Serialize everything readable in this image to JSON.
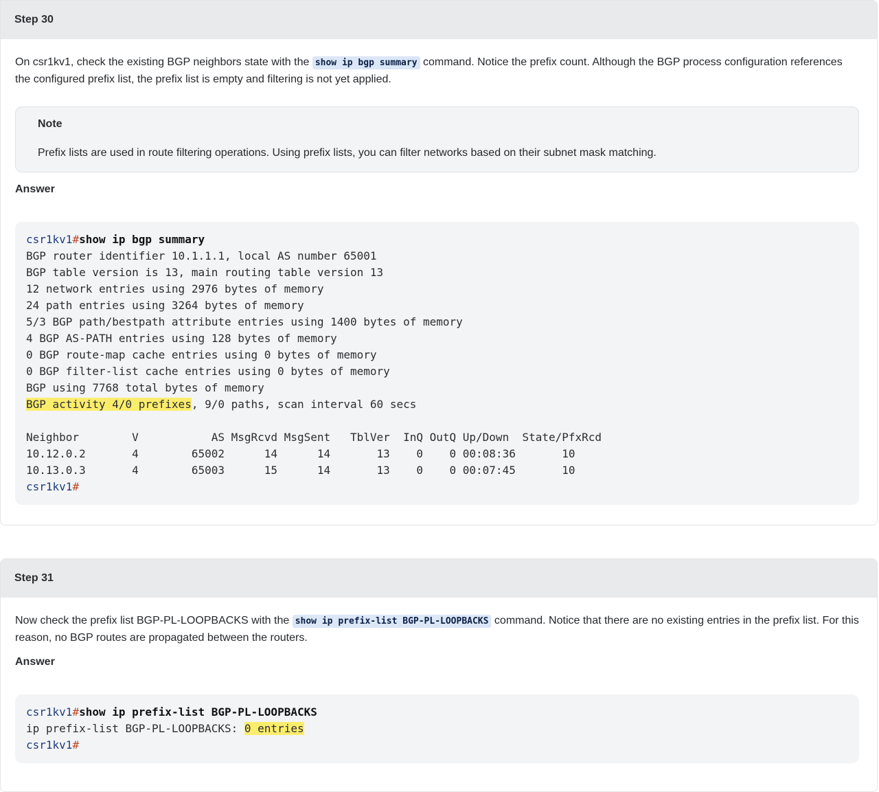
{
  "step30": {
    "title": "Step 30",
    "intro_before": "On csr1kv1, check the existing BGP neighbors state with the ",
    "intro_code": "show ip bgp summary",
    "intro_after": " command. Notice the prefix count. Although the BGP process configuration references the configured prefix list, the prefix list is empty and filtering is not yet applied.",
    "note_title": "Note",
    "note_text": "Prefix lists are used in route filtering operations. Using prefix lists, you can filter networks based on their subnet mask matching.",
    "answer_label": "Answer",
    "code": {
      "prompt": "csr1kv1",
      "hash": "#",
      "command": "show ip bgp summary",
      "lines": [
        "BGP router identifier 10.1.1.1, local AS number 65001",
        "BGP table version is 13, main routing table version 13",
        "12 network entries using 2976 bytes of memory",
        "24 path entries using 3264 bytes of memory",
        "5/3 BGP path/bestpath attribute entries using 1400 bytes of memory",
        "4 BGP AS-PATH entries using 128 bytes of memory",
        "0 BGP route-map cache entries using 0 bytes of memory",
        "0 BGP filter-list cache entries using 0 bytes of memory",
        "BGP using 7768 total bytes of memory"
      ],
      "activity_highlight": "BGP activity 4/0 prefixes",
      "activity_rest": ", 9/0 paths, scan interval 60 secs",
      "table_header": "Neighbor        V           AS MsgRcvd MsgSent   TblVer  InQ OutQ Up/Down  State/PfxRcd",
      "table_rows": [
        "10.12.0.2       4        65002      14      14       13    0    0 00:08:36       10",
        "10.13.0.3       4        65003      15      14       13    0    0 00:07:45       10"
      ],
      "end_prompt": "csr1kv1",
      "end_hash": "#"
    }
  },
  "step31": {
    "title": "Step 31",
    "intro_before": "Now check the prefix list BGP-PL-LOOPBACKS with the ",
    "intro_code": "show ip prefix-list BGP-PL-LOOPBACKS",
    "intro_after": " command. Notice that there are no existing entries in the prefix list. For this reason, no BGP routes are propagated between the routers.",
    "answer_label": "Answer",
    "code": {
      "prompt": "csr1kv1",
      "hash": "#",
      "command": "show ip prefix-list BGP-PL-LOOPBACKS",
      "line_prefix": "ip prefix-list BGP-PL-LOOPBACKS: ",
      "line_highlight": "0 entries",
      "end_prompt": "csr1kv1",
      "end_hash": "#"
    }
  }
}
